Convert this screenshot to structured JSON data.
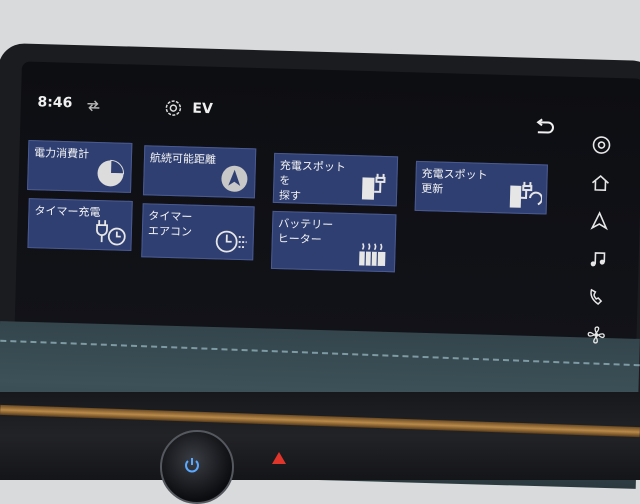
{
  "status": {
    "time": "8:46"
  },
  "header": {
    "title": "EV"
  },
  "tiles": [
    {
      "label": "電力消費計"
    },
    {
      "label": "航続可能距離"
    },
    {
      "label": "充電スポットを\n探す"
    },
    {
      "label": "充電スポット\n更新"
    },
    {
      "label": "タイマー充電"
    },
    {
      "label": "タイマー\nエアコン"
    },
    {
      "label": "バッテリー\nヒーター"
    }
  ],
  "sidebar_icons": [
    "navigation-icon",
    "home-icon",
    "direction-arrow-icon",
    "music-note-icon",
    "phone-icon",
    "fan-icon"
  ],
  "colors": {
    "tile": "#2f3f72",
    "tile_border": "#4a5a90",
    "screen": "#0e0f13",
    "text": "#f4f4f4"
  }
}
